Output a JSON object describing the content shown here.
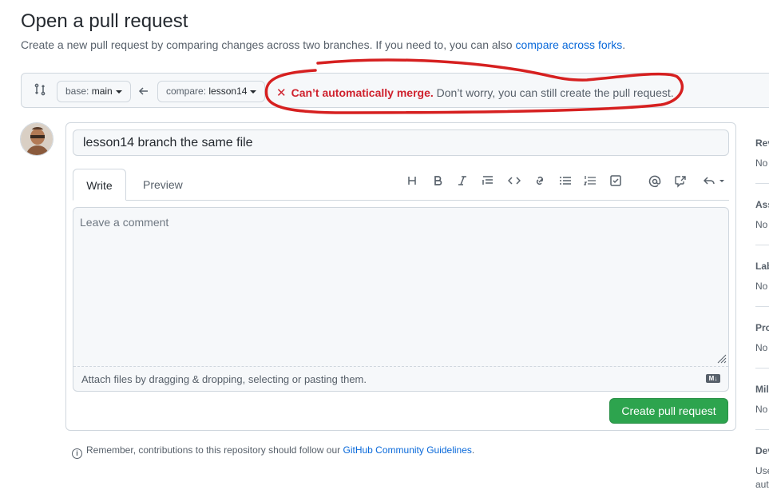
{
  "header": {
    "title": "Open a pull request",
    "subtitle": "Create a new pull request by comparing changes across two branches. If you need to, you can also",
    "subtitle_link": "compare across forks",
    "subtitle_end": "."
  },
  "range": {
    "base_prefix": "base:",
    "base_branch": "main",
    "compare_prefix": "compare:",
    "compare_branch": "lesson14"
  },
  "merge_status": {
    "error": "Can’t automatically merge.",
    "message": "Don’t worry, you can still create the pull request.",
    "color": "#cf222e"
  },
  "form": {
    "title_value": "lesson14 branch the same file",
    "tabs": [
      "Write",
      "Preview"
    ],
    "comment_placeholder": "Leave a comment",
    "attach_text": "Attach files by dragging & dropping, selecting or pasting them.",
    "markdown_badge": "M↓",
    "submit_label": "Create pull request"
  },
  "toolbar": {
    "icons": [
      "heading-icon",
      "bold-icon",
      "italic-icon",
      "quote-icon",
      "code-icon",
      "link-icon",
      "unordered-list-icon",
      "ordered-list-icon",
      "task-list-icon",
      "mention-icon",
      "cross-reference-icon",
      "saved-replies-icon"
    ]
  },
  "footer": {
    "remember_text": "Remember, contributions to this repository should follow our",
    "guidelines_link": "GitHub Community Guidelines",
    "end": "."
  },
  "sidebar": {
    "items": [
      {
        "heading": "Rev",
        "value": "No"
      },
      {
        "heading": "Ass",
        "value": "No"
      },
      {
        "heading": "Lab",
        "value": "No"
      },
      {
        "heading": "Pro",
        "value": "No"
      },
      {
        "heading": "Mil",
        "value": "No"
      },
      {
        "heading": "Dev",
        "value": "Use"
      },
      {
        "heading": "",
        "value": "aut"
      }
    ]
  },
  "colors": {
    "accent": "#0969da",
    "primary_button": "#2da44e",
    "annotation": "#d62020"
  }
}
